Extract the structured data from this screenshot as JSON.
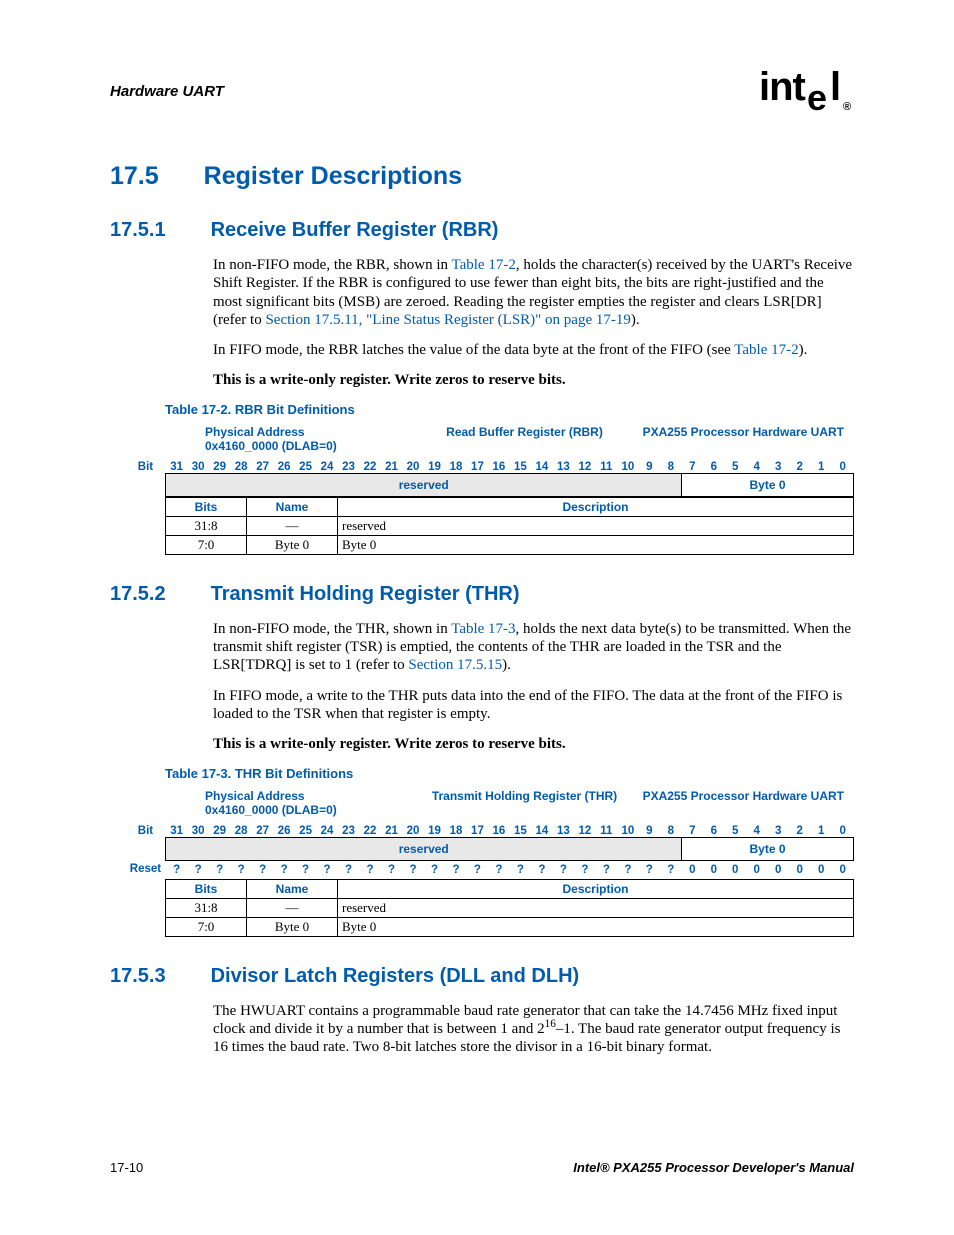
{
  "header": {
    "title": "Hardware UART",
    "logo": "intel"
  },
  "h1": {
    "num": "17.5",
    "title": "Register Descriptions"
  },
  "s1": {
    "num": "17.5.1",
    "title": "Receive Buffer Register (RBR)",
    "p1a": "In non-FIFO mode, the RBR, shown in ",
    "p1link1": "Table 17-2",
    "p1b": ", holds the character(s) received by the UART's Receive Shift Register. If the RBR is configured to use fewer than eight bits, the bits are right-justified and the most significant bits (MSB) are zeroed. Reading the register empties the register and clears LSR[DR] (refer to ",
    "p1link2": "Section 17.5.11, \"Line Status Register (LSR)\" on page 17-19",
    "p1c": ").",
    "p2a": "In FIFO mode, the RBR latches the value of the data byte at the front of the FIFO (see ",
    "p2link": "Table 17-2",
    "p2b": ").",
    "p3": "This is a write-only register. Write zeros to reserve bits.",
    "caption": "Table 17-2. RBR Bit Definitions",
    "addr1": "Physical Address",
    "addr2": "0x4160_0000 (DLAB=0)",
    "regname": "Read Buffer Register (RBR)",
    "chip": "PXA255 Processor Hardware UART",
    "bitlabel": "Bit",
    "reserved": "reserved",
    "byte0": "Byte 0",
    "th_bits": "Bits",
    "th_name": "Name",
    "th_desc": "Description",
    "row1": {
      "bits": "31:8",
      "name": "—",
      "desc": "reserved"
    },
    "row2": {
      "bits": "7:0",
      "name": "Byte 0",
      "desc": "Byte 0"
    }
  },
  "s2": {
    "num": "17.5.2",
    "title": "Transmit Holding Register (THR)",
    "p1a": "In non-FIFO mode, the THR, shown in ",
    "p1link1": "Table 17-3",
    "p1b": ", holds the next data byte(s) to be transmitted. When the transmit shift register (TSR) is emptied, the contents of the THR are loaded in the TSR and the LSR[TDRQ] is set to 1 (refer to ",
    "p1link2": "Section 17.5.15",
    "p1c": ").",
    "p2": "In FIFO mode, a write to the THR puts data into the end of the FIFO. The data at the front of the FIFO is loaded to the TSR when that register is empty.",
    "p3": "This is a write-only register. Write zeros to reserve bits.",
    "caption": "Table 17-3. THR Bit Definitions",
    "addr1": "Physical Address",
    "addr2": "0x4160_0000 (DLAB=0)",
    "regname": "Transmit Holding Register (THR)",
    "chip": "PXA255 Processor Hardware UART",
    "bitlabel": "Bit",
    "resetlabel": "Reset",
    "reserved": "reserved",
    "byte0": "Byte 0",
    "q": "?",
    "z": "0",
    "th_bits": "Bits",
    "th_name": "Name",
    "th_desc": "Description",
    "row1": {
      "bits": "31:8",
      "name": "—",
      "desc": "reserved"
    },
    "row2": {
      "bits": "7:0",
      "name": "Byte 0",
      "desc": "Byte 0"
    }
  },
  "s3": {
    "num": "17.5.3",
    "title": "Divisor Latch Registers (DLL and DLH)",
    "p1a": "The HWUART contains a programmable baud rate generator that can take the 14.7456 MHz fixed input clock and divide it by a number that is between 1 and 2",
    "p1sup": "16",
    "p1b": "–1. The baud rate generator output frequency is 16 times the baud rate. Two 8-bit latches store the divisor in a 16-bit binary format."
  },
  "bits": [
    "31",
    "30",
    "29",
    "28",
    "27",
    "26",
    "25",
    "24",
    "23",
    "22",
    "21",
    "20",
    "19",
    "18",
    "17",
    "16",
    "15",
    "14",
    "13",
    "12",
    "11",
    "10",
    "9",
    "8",
    "7",
    "6",
    "5",
    "4",
    "3",
    "2",
    "1",
    "0"
  ],
  "footer": {
    "page": "17-10",
    "manual": "Intel® PXA255 Processor Developer's Manual"
  }
}
